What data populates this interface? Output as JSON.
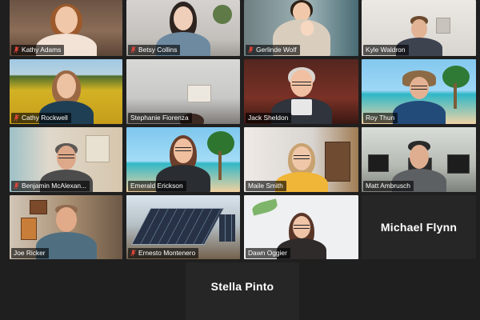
{
  "participants": [
    {
      "name": "Kathy Adams",
      "muted": true
    },
    {
      "name": "Betsy Collins",
      "muted": true
    },
    {
      "name": "Gerlinde Wolf",
      "muted": true
    },
    {
      "name": "Kyle Waldron",
      "muted": false
    },
    {
      "name": "Cathy Rockwell",
      "muted": true
    },
    {
      "name": "Stephanie Fiorenza",
      "muted": false
    },
    {
      "name": "Jack Sheldon",
      "muted": false
    },
    {
      "name": "Roy Thun",
      "muted": false
    },
    {
      "name": "Benjamin McAlexan...",
      "muted": true
    },
    {
      "name": "Emerald Erickson",
      "muted": false
    },
    {
      "name": "Maile Smith",
      "muted": false
    },
    {
      "name": "Matt Ambrusch",
      "muted": false,
      "active_speaker": true
    },
    {
      "name": "Joe Ricker",
      "muted": false
    },
    {
      "name": "Ernesto Montenero",
      "muted": true
    },
    {
      "name": "Dawn Oggier",
      "muted": false
    },
    {
      "name": "Michael Flynn",
      "video": false
    },
    {
      "name": "Stella Pinto",
      "video": false
    }
  ],
  "colors": {
    "active_border": "#c8e64a",
    "muted_icon": "#e0453a",
    "background": "#1f1f1f",
    "tile_off": "#262626"
  },
  "icons": {
    "muted": "microphone-muted-icon"
  }
}
